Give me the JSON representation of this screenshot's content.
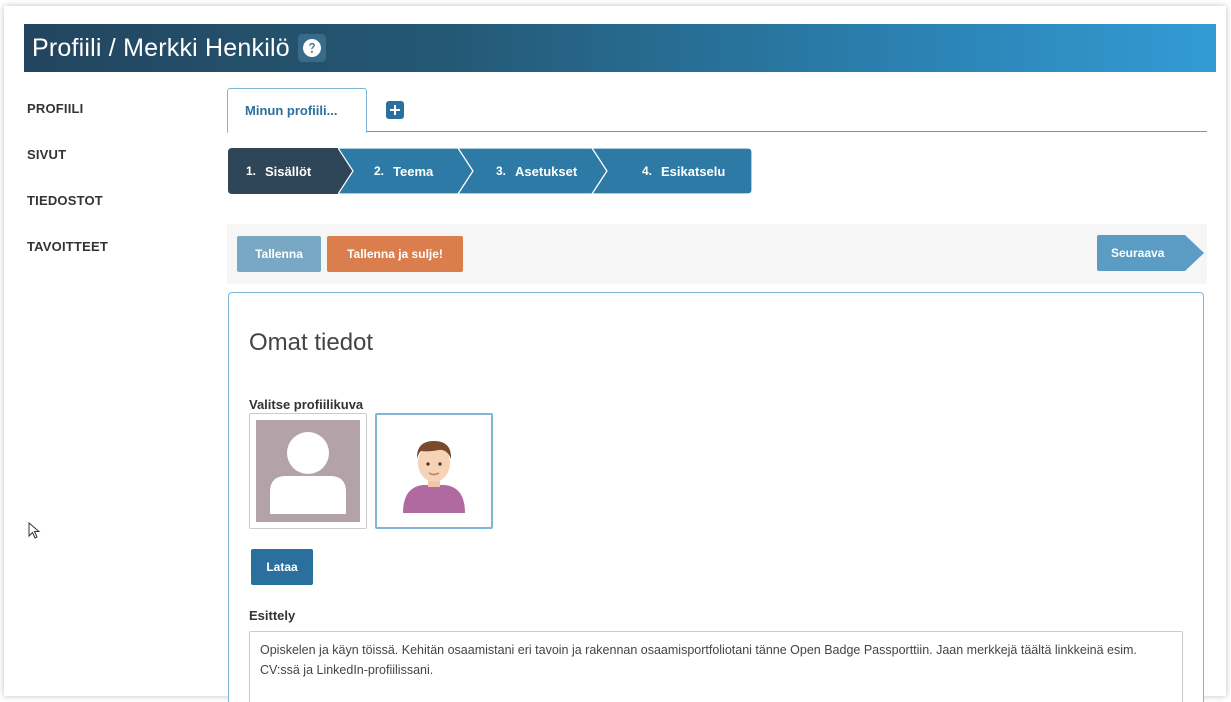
{
  "header": {
    "title": "Profiili / Merkki Henkilö",
    "help_icon": "question-circle-icon"
  },
  "sidebar": {
    "items": [
      {
        "label": "PROFIILI"
      },
      {
        "label": "SIVUT"
      },
      {
        "label": "TIEDOSTOT"
      },
      {
        "label": "TAVOITTEET"
      }
    ]
  },
  "tabs": {
    "active_label": "Minun profiili...",
    "add_icon": "plus-square-icon"
  },
  "wizard": {
    "steps": [
      {
        "num": "1.",
        "label": "Sisällöt",
        "active": true
      },
      {
        "num": "2.",
        "label": "Teema",
        "active": false
      },
      {
        "num": "3.",
        "label": "Asetukset",
        "active": false
      },
      {
        "num": "4.",
        "label": "Esikatselu",
        "active": false
      }
    ]
  },
  "toolbar": {
    "save_label": "Tallenna",
    "save_close_label": "Tallenna ja sulje!",
    "next_label": "Seuraava"
  },
  "content": {
    "title": "Omat tiedot",
    "pic_label": "Valitse profiilikuva",
    "upload_label": "Lataa",
    "intro_label": "Esittely",
    "intro_text": "Opiskelen  ja käyn töissä. Kehitän osaamistani eri tavoin ja rakennan osaamisportfoliotani tänne Open Badge Passporttiin. Jaan merkkejä täältä linkkeinä esim. CV:ssä ja LinkedIn-profiilissani."
  },
  "colors": {
    "header_dark": "#23455f",
    "header_light": "#339bd4",
    "step_active": "#2f4658",
    "step_inactive": "#2d7aa6",
    "save": "#79a8c4",
    "save_close": "#db7e4d",
    "next": "#5a9cc4",
    "upload": "#2a6f9d"
  }
}
